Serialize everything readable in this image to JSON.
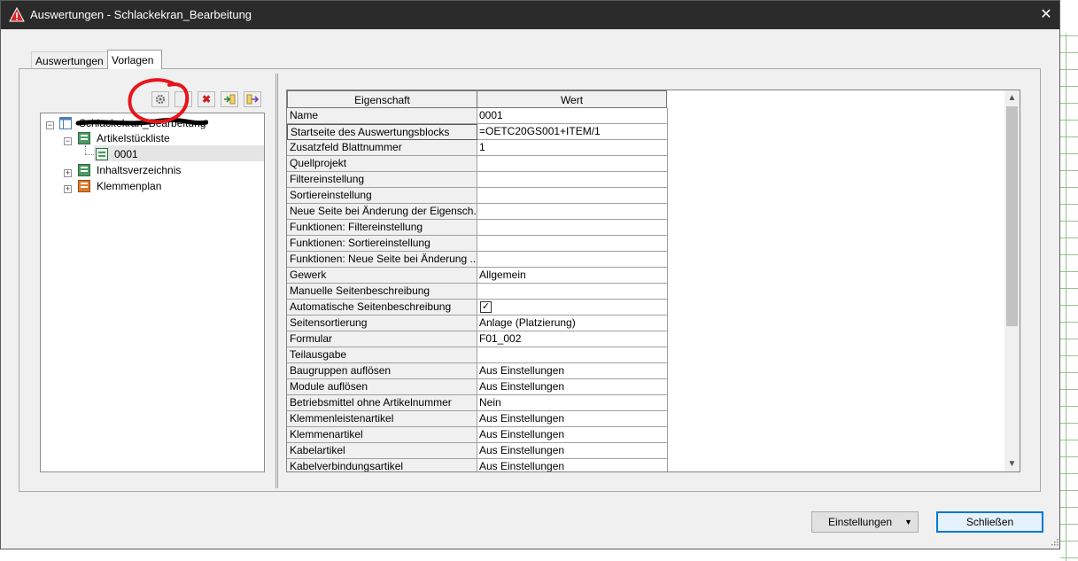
{
  "window": {
    "title": "Auswertungen - Schlackekran_Bearbeitung",
    "close_glyph": "✕",
    "app_icon": "warning-triangle-icon"
  },
  "tabs": [
    {
      "label": "Auswertungen"
    },
    {
      "label": "Vorlagen"
    }
  ],
  "toolbar": {
    "icons": [
      "gear-icon",
      "blank-icon",
      "delete-icon",
      "import-icon",
      "export-icon"
    ],
    "delete_glyph": "✖"
  },
  "tree": {
    "root": {
      "label": "Schlackekran_Bearbeitung"
    },
    "items": [
      {
        "label": "Artikelstückliste",
        "children": [
          {
            "label": "0001"
          }
        ]
      },
      {
        "label": "Inhaltsverzeichnis"
      },
      {
        "label": "Klemmenplan"
      }
    ]
  },
  "grid": {
    "headers": {
      "property": "Eigenschaft",
      "value": "Wert"
    },
    "rows": [
      {
        "property": "Name",
        "value": "0001"
      },
      {
        "property": "Startseite des Auswertungsblocks",
        "value": "=OETC20GS001+ITEM/1"
      },
      {
        "property": "Zusatzfeld Blattnummer",
        "value": "1"
      },
      {
        "property": "Quellprojekt",
        "value": ""
      },
      {
        "property": "Filtereinstellung",
        "value": ""
      },
      {
        "property": "Sortiereinstellung",
        "value": ""
      },
      {
        "property": "Neue Seite bei Änderung der Eigensch...",
        "value": ""
      },
      {
        "property": "Funktionen: Filtereinstellung",
        "value": ""
      },
      {
        "property": "Funktionen: Sortiereinstellung",
        "value": ""
      },
      {
        "property": "Funktionen: Neue Seite bei Änderung ...",
        "value": ""
      },
      {
        "property": "Gewerk",
        "value": "Allgemein"
      },
      {
        "property": "Manuelle Seitenbeschreibung",
        "value": ""
      },
      {
        "property": "Automatische Seitenbeschreibung",
        "value": "",
        "checked": true
      },
      {
        "property": "Seitensortierung",
        "value": "Anlage (Platzierung)"
      },
      {
        "property": "Formular",
        "value": "F01_002"
      },
      {
        "property": "Teilausgabe",
        "value": ""
      },
      {
        "property": "Baugruppen auflösen",
        "value": "Aus Einstellungen"
      },
      {
        "property": "Module auflösen",
        "value": "Aus Einstellungen"
      },
      {
        "property": "Betriebsmittel ohne Artikelnummer",
        "value": "Nein"
      },
      {
        "property": "Klemmenleistenartikel",
        "value": "Aus Einstellungen"
      },
      {
        "property": "Klemmenartikel",
        "value": "Aus Einstellungen"
      },
      {
        "property": "Kabelartikel",
        "value": "Aus Einstellungen"
      },
      {
        "property": "Kabelverbindungsartikel",
        "value": "Aus Einstellungen"
      }
    ]
  },
  "buttons": {
    "settings": "Einstellungen",
    "close": "Schließen"
  },
  "colors": {
    "titlebar": "#2b2b2b",
    "annotation": "#e8141c",
    "accent": "#0078d7"
  }
}
